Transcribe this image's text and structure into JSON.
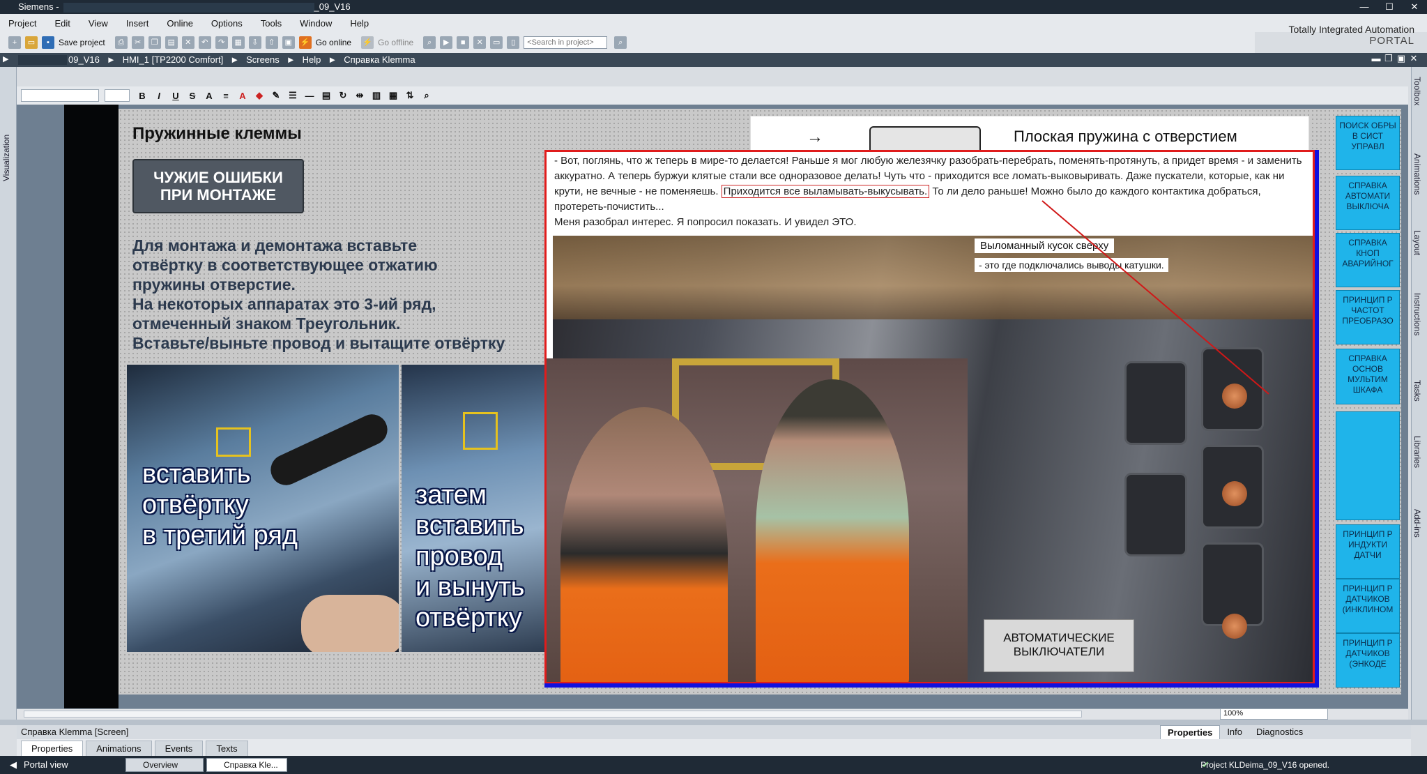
{
  "app": {
    "title": "Siemens -",
    "title_suffix": "_09_V16",
    "brand_line1": "Totally Integrated Automation",
    "brand_line2": "PORTAL"
  },
  "menu": [
    "Project",
    "Edit",
    "View",
    "Insert",
    "Online",
    "Options",
    "Tools",
    "Window",
    "Help"
  ],
  "toolbar": {
    "save_label": "Save project",
    "go_online": "Go online",
    "go_offline": "Go offline",
    "search_placeholder": "<Search in project>"
  },
  "breadcrumb": [
    "09_V16",
    "HMI_1 [TP2200 Comfort]",
    "Screens",
    "Help",
    "Справка Klemma"
  ],
  "left_panel": {
    "label": "Visualization"
  },
  "right_tabs": [
    "Toolbox",
    "Animations",
    "Layout",
    "Instructions",
    "Tasks",
    "Libraries",
    "Add-ins"
  ],
  "screen": {
    "title": "Пружинные клеммы",
    "error_button": "ЧУЖИЕ ОШИБКИ\nПРИ МОНТАЖЕ",
    "instructions": "Для монтажа и демонтажа вставьте\nотвёртку в соответствующее отжатию\nпружины отверстие.\nНа некоторых аппаратах это 3-ий ряд,\nотмеченный знаком Треугольник.\nВставьте/выньте провод и вытащите отвёртку",
    "photo1_text": "вставить\nотвёртку\nв третий ряд",
    "photo2_text": "затем\nвставить\nпровод\nи вынуть\nотвёртку",
    "diagram_label": "Плоская пружина с отверстием",
    "diagram_arrow": "→",
    "popup_text_a": "- Вот, поглянь, что ж теперь в мире-то делается! Раньше я мог любую железячку разобрать-перебрать, поменять-протянуть, а придет время - и заменить аккуратно. А теперь буржуи клятые стали все одноразовое делать! Чуть что - приходится все ломать-выковыривать. Даже пускатели, которые, как ни крути, не вечные - не поменяешь.",
    "popup_text_highlight": "Приходится все выламывать-выкусывать.",
    "popup_text_b": "То ли дело раньше! Можно было до каждого контактика добраться, протереть-почистить...",
    "popup_text_c": "Меня разобрал интерес.  Я попросил показать. И увидел ЭТО.",
    "caption1": "Выломанный кусок сверху",
    "caption2": "- это где подключались выводы катушки.",
    "auto_button": "АВТОМАТИЧЕСКИЕ\nВЫКЛЮЧАТЕЛИ",
    "side_buttons": [
      "ПОИСК ОБРЫ\nВ СИСТ\nУПРАВЛ",
      "СПРАВКА\nАВТОМАТИ\nВЫКЛЮЧА",
      "СПРАВКА\nКНОП\nАВАРИЙНОГ",
      "ПРИНЦИП Р\nЧАСТОТ\nПРЕОБРАЗО",
      "СПРАВКА\nОСНОВ\nМУЛЬТИМ\nШКАФА",
      "",
      "ПРИНЦИП Р\nИНДУКТИ\nДАТЧИ",
      "ПРИНЦИП Р\nДАТЧИКОВ\n(ИНКЛИНОМ",
      "ПРИНЦИП Р\nДАТЧИКОВ\n(ЭНКОДЕ"
    ]
  },
  "zoom": "100%",
  "properties": {
    "title": "Справка Klemma [Screen]",
    "tabs": [
      "Properties",
      "Info",
      "Diagnostics"
    ],
    "subtabs": [
      "Properties",
      "Animations",
      "Events",
      "Texts"
    ]
  },
  "status": {
    "portal": "Portal view",
    "tab1": "Overview",
    "tab2": "Справка Kle...",
    "message": "Project KLDeima_09_V16 opened."
  }
}
